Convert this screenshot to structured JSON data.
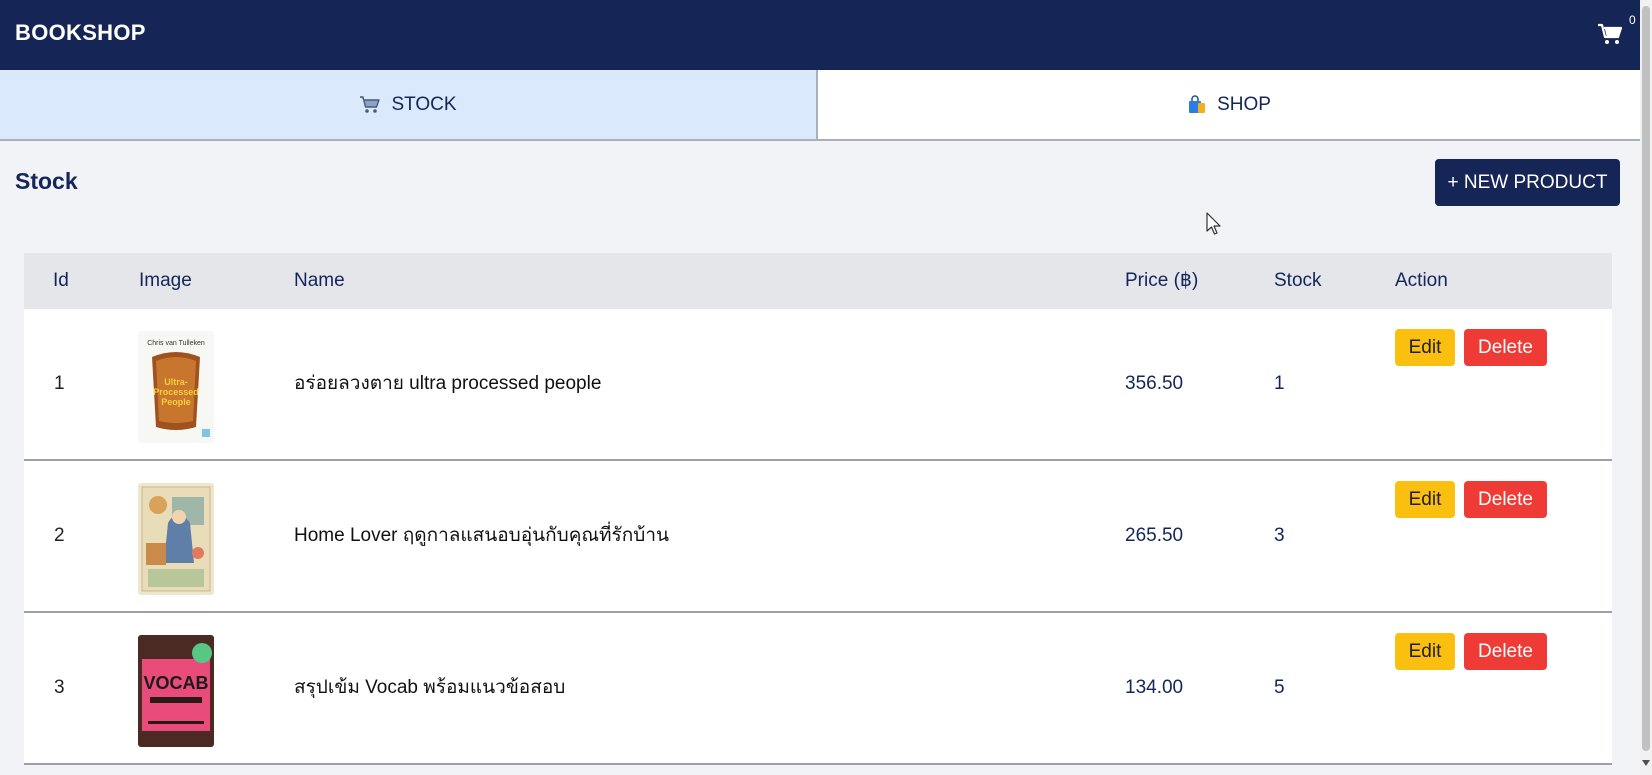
{
  "header": {
    "brand": "BOOKSHOP",
    "cart_icon": "shopping-cart-icon",
    "cart_count": "0"
  },
  "tabs": [
    {
      "label": "STOCK",
      "icon": "cart-icon",
      "active": true
    },
    {
      "label": "SHOP",
      "icon": "shopping-bag-icon",
      "active": false
    }
  ],
  "page": {
    "title": "Stock",
    "new_button": "+ NEW PRODUCT"
  },
  "table": {
    "headers": [
      "Id",
      "Image",
      "Name",
      "Price (฿)",
      "Stock",
      "Action"
    ],
    "rows": [
      {
        "id": "1",
        "name": "อร่อยลวงตาย ultra processed people",
        "price": "356.50",
        "stock": "1",
        "edit": "Edit",
        "delete": "Delete",
        "cover_title": "Ultra-Processed People",
        "cover_author": "Chris van Tulleken"
      },
      {
        "id": "2",
        "name": "Home Lover ฤดูกาลแสนอบอุ่นกับคุณที่รักบ้าน",
        "price": "265.50",
        "stock": "3",
        "edit": "Edit",
        "delete": "Delete"
      },
      {
        "id": "3",
        "name": "สรุปเข้ม Vocab พร้อมแนวข้อสอบ",
        "price": "134.00",
        "stock": "5",
        "edit": "Edit",
        "delete": "Delete",
        "cover_title": "VOCAB"
      }
    ]
  },
  "colors": {
    "navbar": "#152555",
    "active_tab": "#dbe9fc",
    "edit": "#fbbf0f",
    "delete": "#ef3b36"
  }
}
